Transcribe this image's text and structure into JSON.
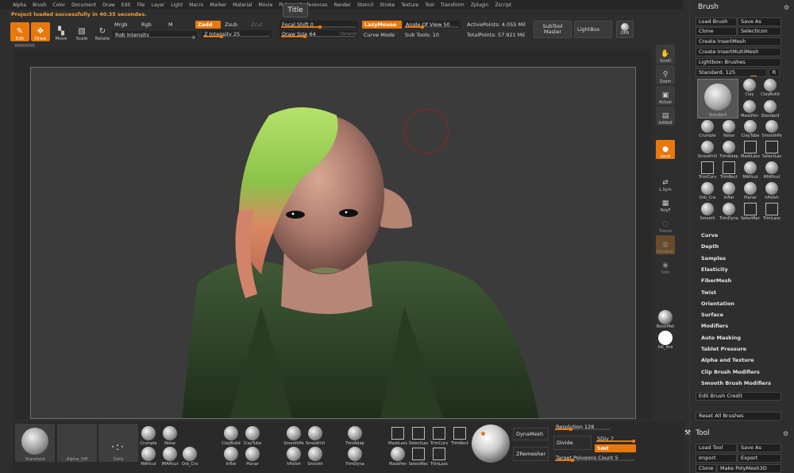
{
  "menu": [
    "Alpha",
    "Brush",
    "Color",
    "Document",
    "Draw",
    "Edit",
    "File",
    "Layer",
    "Light",
    "Macro",
    "Marker",
    "Material",
    "Movie",
    "Picker",
    "Preferences",
    "Render",
    "Stencil",
    "Stroke",
    "Texture",
    "Tool",
    "Transform",
    "Zplugin",
    "Zscript"
  ],
  "title_button": "Title",
  "status_message": "Project loaded successfully in 40.35 secondes.",
  "toolbar": {
    "edit": "Edit",
    "draw": "Draw",
    "move": "Move",
    "scale": "Scale",
    "rotate": "Rotate",
    "mrgb": "Mrgb",
    "rgb": "Rgb",
    "m": "M",
    "rgb_intensity": "Rgb Intensity",
    "zadd": "Zadd",
    "zsub": "Zsub",
    "zcut": "Zcut",
    "z_intensity": "Z Intensity 25",
    "focal_shift": "Focal Shift 0",
    "draw_size": "Draw Size 64",
    "dynamic": "Dynamic",
    "lazymouse": "LazyMouse",
    "curve_mode": "Curve Mode",
    "angle_of_view": "Angle Of View 50",
    "sub_tools": "Sub Tools: 10",
    "active_points": "ActivePoints: 4.055 Mil",
    "total_points": "TotalPoints: 57.921 Mil",
    "subtool_master": "SubTool Master",
    "lightbox": "LightBox",
    "dpr": "DPR"
  },
  "right_shelf": {
    "scroll": "Scroll",
    "zoom": "Zoom",
    "actual": "Actual",
    "aahalf": "AAHalf",
    "local": "Local",
    "lsym": "L.Sym",
    "polyf": "PolyF",
    "transp": "Transp",
    "dynamic": "Dynamic",
    "solo": "Solo",
    "basicmat": "BasicMat",
    "ink_line": "Ink_line"
  },
  "panel": {
    "brush_title": "Brush",
    "load_brush": "Load Brush",
    "save_as": "Save As",
    "clone": "Clone",
    "select_icon": "SelectIcon",
    "create_insertmesh": "Create InsertMesh",
    "create_insertmultimesh": "Create InsertMultiMesh",
    "lightbox_brushes": "Lightbox› Brushes",
    "standard_value": "Standard. 125",
    "r": "R",
    "big_brush": "Standard",
    "brushes": [
      "Clay",
      "ClayBuild",
      "MaskPen",
      "Standard",
      "Crumple",
      "Noise",
      "ClayTube",
      "SmoothPe",
      "SmoothVi",
      "TrimAdap",
      "MaskLass",
      "SelectLas",
      "TrimCurv",
      "TrimRect",
      "MAHcut",
      "IMAHcut",
      "Orb_Cra",
      "Inflat",
      "Planar",
      "hPolish",
      "Smooth",
      "TrimDyna",
      "SelectRec",
      "TrimLass"
    ],
    "sections": [
      "Curve",
      "Depth",
      "Samples",
      "Elasticity",
      "FiberMesh",
      "Twist",
      "Orientation",
      "Surface",
      "Modifiers",
      "Auto Masking",
      "Tablet Pressure",
      "Alpha and Texture",
      "Clip Brush Modifiers",
      "Smooth Brush Modifiers"
    ],
    "edit_brush_credit": "Edit Brush Credit",
    "reset_all_brushes": "Reset All Brushes",
    "tool_title": "Tool",
    "load_tool": "Load Tool",
    "tool_save_as": "Save As",
    "import": "Import",
    "export": "Export",
    "tool_clone": "Clone",
    "make_polymesh": "Make PolyMesh3D"
  },
  "bottom": {
    "standard": "Standard",
    "alpha_off": "Alpha_Off",
    "dots": "Dots",
    "thumbs": [
      "Crumple",
      "Noise",
      "MAHcut",
      "IMAHcut",
      "Orb_Cra",
      "ClayBuild",
      "ClayTube",
      "Inflat",
      "Planar",
      "SmoothPe",
      "SmoothVi",
      "hPolish",
      "Smooth",
      "TrimAdap",
      "TrimDyna",
      "MaskLass",
      "SelectLas",
      "TrimCurv",
      "TrimRect",
      "MaskPen",
      "SelectRec",
      "TrimLass"
    ],
    "dynamesh": "DynaMesh",
    "zremesher": "ZRemesher",
    "resolution": "Resolution 128",
    "divide": "Divide",
    "sdiv": "SDiv 7",
    "smt": "Smt",
    "target_polygons": "Target Polygons Count 5"
  },
  "colors": {
    "accent": "#e8780c",
    "panel_bg": "#2e2e2e",
    "viewport_bg": "#3b3b3b"
  }
}
